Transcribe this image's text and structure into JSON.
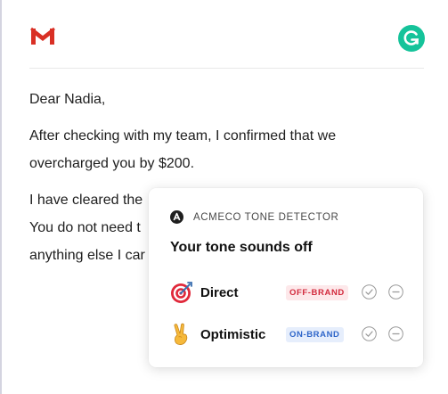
{
  "header": {
    "mail_icon": "gmail-icon",
    "assistant_icon": "grammarly-icon",
    "colors": {
      "gmail_red": "#d93025",
      "grammarly_green": "#15c39a"
    }
  },
  "email": {
    "greeting": "Dear Nadia,",
    "line1": "After checking with my team, I confirmed that we",
    "line2": "overcharged you by $200.",
    "line3": "I have cleared the",
    "line4": "You do not need t",
    "line5": "anything else I car"
  },
  "tone_popup": {
    "brand_name": "ACMECO TONE DETECTOR",
    "brand_icon": "acmeco-logo-icon",
    "title": "Your tone sounds off",
    "tones": [
      {
        "label": "Direct",
        "emoji": "direct-hit-icon",
        "badge": "OFF-BRAND",
        "badge_color": "#d22a3d",
        "actions": [
          "accept-check-icon",
          "dismiss-minus-icon"
        ]
      },
      {
        "label": "Optimistic",
        "emoji": "victory-hand-icon",
        "badge": "ON-BRAND",
        "badge_color": "#2f66c9",
        "actions": [
          "accept-check-icon",
          "dismiss-minus-icon"
        ]
      }
    ]
  }
}
